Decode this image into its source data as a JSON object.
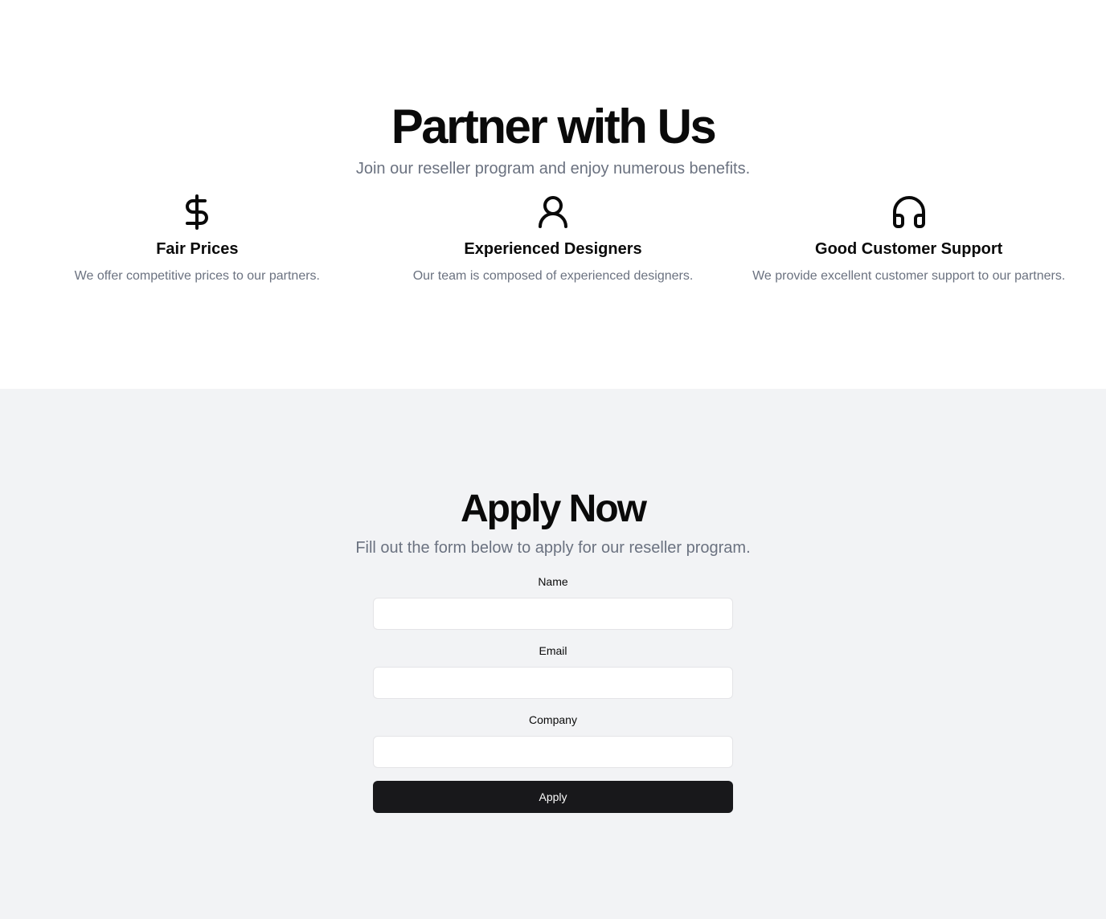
{
  "hero": {
    "title": "Partner with Us",
    "subtitle": "Join our reseller program and enjoy numerous benefits."
  },
  "features": [
    {
      "icon": "dollar-icon",
      "title": "Fair Prices",
      "description": "We offer competitive prices to our partners."
    },
    {
      "icon": "user-icon",
      "title": "Experienced Designers",
      "description": "Our team is composed of experienced designers."
    },
    {
      "icon": "headphones-icon",
      "title": "Good Customer Support",
      "description": "We provide excellent customer support to our partners."
    }
  ],
  "apply": {
    "title": "Apply Now",
    "subtitle": "Fill out the form below to apply for our reseller program.",
    "fields": {
      "name": {
        "label": "Name",
        "value": ""
      },
      "email": {
        "label": "Email",
        "value": ""
      },
      "company": {
        "label": "Company",
        "value": ""
      }
    },
    "submit_label": "Apply"
  },
  "colors": {
    "text": "#0a0a0a",
    "muted": "#6b7280",
    "section_bg": "#f2f3f5",
    "button_bg": "#18181b",
    "button_text": "#fafafa"
  }
}
